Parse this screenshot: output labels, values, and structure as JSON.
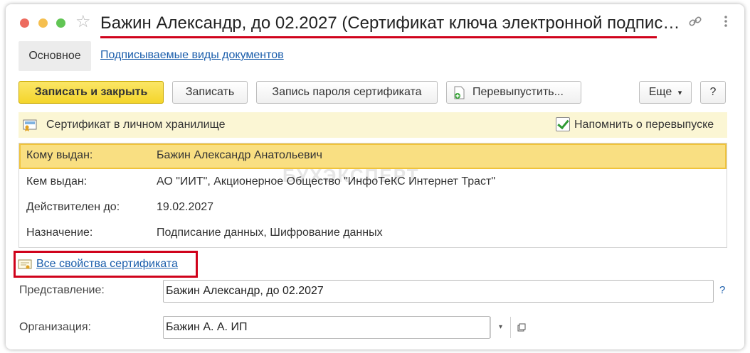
{
  "window": {
    "title": "Бажин Александр, до 02.2027 (Сертификат ключа электронной подписи ...",
    "icons": [
      "star-icon",
      "link-icon",
      "more-vertical-icon",
      "close-icon"
    ]
  },
  "tabs": {
    "main": "Основное",
    "doc_types": "Подписываемые виды документов"
  },
  "toolbar": {
    "save_close": "Записать и закрыть",
    "save": "Записать",
    "password": "Запись пароля сертификата",
    "reissue": "Перевыпустить...",
    "more": "Еще",
    "more_caret": "▾",
    "help": "?"
  },
  "info": {
    "storage_text": "Сертификат в личном хранилище",
    "remind_label": "Напомнить о перевыпуске",
    "remind_checked": true
  },
  "details": {
    "watermark": "БУХЭКСПЕРТ",
    "rows": [
      {
        "label": "Кому выдан:",
        "value": "Бажин Александр Анатольевич",
        "selected": true
      },
      {
        "label": "Кем выдан:",
        "value": "АО \"ИИТ\", Акционерное Общество \"ИнфоТеКС Интернет Траст\"",
        "selected": false
      },
      {
        "label": "Действителен до:",
        "value": "19.02.2027",
        "selected": false
      },
      {
        "label": "Назначение:",
        "value": "Подписание данных, Шифрование данных",
        "selected": false
      }
    ]
  },
  "all_props_link": "Все свойства сертификата",
  "form": {
    "representation_label": "Представление:",
    "representation_value": "Бажин Александр, до 02.2027",
    "representation_help": "?",
    "organization_label": "Организация:",
    "organization_value": "Бажин А. А. ИП",
    "organization_drop": "▾"
  },
  "colors": {
    "primary_button": "#f4d52b",
    "link": "#1a5dab",
    "highlight_row": "#f9df82",
    "info_strip": "#fbf6d4",
    "annotation": "#d0021b"
  }
}
